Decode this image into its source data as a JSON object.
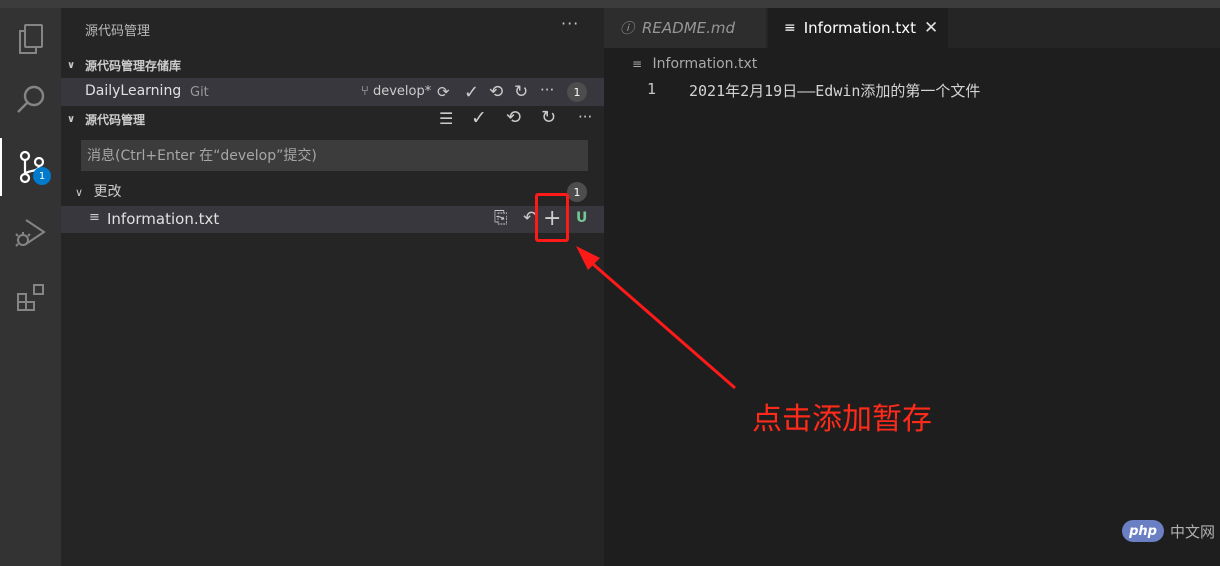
{
  "activity_bar": {
    "items": [
      "explorer-icon",
      "search-icon",
      "source-control-icon",
      "run-debug-icon",
      "extensions-icon"
    ],
    "scm_badge": "1"
  },
  "sidebar": {
    "title": "源代码管理",
    "more_glyph": "···",
    "repos_section_title": "源代码管理存储库",
    "repo": {
      "name": "DailyLearning",
      "type": "Git",
      "branch": "develop*",
      "count": "1"
    },
    "scm_section_title": "源代码管理",
    "commit_placeholder": "消息(Ctrl+Enter 在“develop”提交)",
    "changes": {
      "label": "更改",
      "count": "1",
      "files": [
        {
          "name": "Information.txt",
          "status": "U"
        }
      ]
    }
  },
  "editor": {
    "tabs": [
      {
        "label": "README.md",
        "active": false
      },
      {
        "label": "Information.txt",
        "active": true
      }
    ],
    "breadcrumb": "Information.txt",
    "lines": [
      {
        "number": "1",
        "text": "2021年2月19日——Edwin添加的第一个文件"
      }
    ]
  },
  "annotation": {
    "text": "点击添加暂存",
    "color": "#ff2a1a"
  },
  "watermark": {
    "logo": "php",
    "text": "中文网"
  },
  "colors": {
    "accent": "#007acc",
    "untracked": "#73c991"
  }
}
